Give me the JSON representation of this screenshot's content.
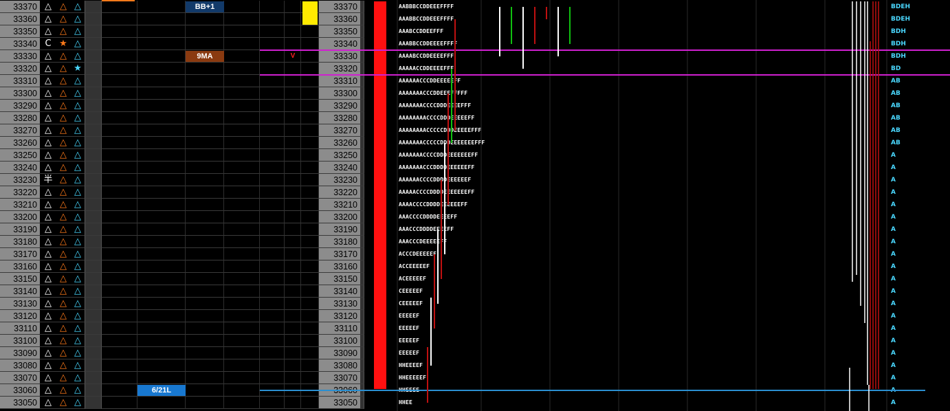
{
  "prices": [
    33370,
    33360,
    33350,
    33340,
    33330,
    33320,
    33310,
    33300,
    33290,
    33280,
    33270,
    33260,
    33250,
    33240,
    33230,
    33220,
    33210,
    33200,
    33190,
    33180,
    33170,
    33160,
    33150,
    33140,
    33130,
    33120,
    33110,
    33100,
    33090,
    33080,
    33070,
    33060,
    33050
  ],
  "icon_rows": [
    {
      "c1": "△",
      "c2": "△",
      "c3": "△"
    },
    {
      "c1": "△",
      "c2": "△",
      "c3": "△"
    },
    {
      "c1": "△",
      "c2": "△",
      "c3": "△"
    },
    {
      "c1": "C",
      "c2": "★",
      "c3": "△"
    },
    {
      "c1": "△",
      "c2": "△",
      "c3": "△"
    },
    {
      "c1": "△",
      "c2": "△",
      "c3": "★"
    },
    {
      "c1": "△",
      "c2": "△",
      "c3": "△"
    },
    {
      "c1": "△",
      "c2": "△",
      "c3": "△"
    },
    {
      "c1": "△",
      "c2": "△",
      "c3": "△"
    },
    {
      "c1": "△",
      "c2": "△",
      "c3": "△"
    },
    {
      "c1": "△",
      "c2": "△",
      "c3": "△"
    },
    {
      "c1": "△",
      "c2": "△",
      "c3": "△"
    },
    {
      "c1": "△",
      "c2": "△",
      "c3": "△"
    },
    {
      "c1": "△",
      "c2": "△",
      "c3": "△"
    },
    {
      "c1": "半",
      "c2": "△",
      "c3": "△"
    },
    {
      "c1": "△",
      "c2": "△",
      "c3": "△"
    },
    {
      "c1": "△",
      "c2": "△",
      "c3": "△"
    },
    {
      "c1": "△",
      "c2": "△",
      "c3": "△"
    },
    {
      "c1": "△",
      "c2": "△",
      "c3": "△"
    },
    {
      "c1": "△",
      "c2": "△",
      "c3": "△"
    },
    {
      "c1": "△",
      "c2": "△",
      "c3": "△"
    },
    {
      "c1": "△",
      "c2": "△",
      "c3": "△"
    },
    {
      "c1": "△",
      "c2": "△",
      "c3": "△"
    },
    {
      "c1": "△",
      "c2": "△",
      "c3": "△"
    },
    {
      "c1": "△",
      "c2": "△",
      "c3": "△"
    },
    {
      "c1": "△",
      "c2": "△",
      "c3": "△"
    },
    {
      "c1": "△",
      "c2": "△",
      "c3": "△"
    },
    {
      "c1": "△",
      "c2": "△",
      "c3": "△"
    },
    {
      "c1": "△",
      "c2": "△",
      "c3": "△"
    },
    {
      "c1": "△",
      "c2": "△",
      "c3": "△"
    },
    {
      "c1": "△",
      "c2": "△",
      "c3": "△"
    },
    {
      "c1": "△",
      "c2": "△",
      "c3": "△"
    },
    {
      "c1": "△",
      "c2": "△",
      "c3": "△"
    }
  ],
  "tags": {
    "bb": {
      "label": "BB+1",
      "price": 33370
    },
    "ma": {
      "label": "9MA",
      "price": 33330
    },
    "low": {
      "label": "6/21L",
      "price": 33060
    },
    "v": {
      "label": "V",
      "price": 33330
    }
  },
  "tpo_profile": [
    "AABBBCCDDEEEFFFF",
    "AAABBCCDDEEEFFFF",
    "AAABCCDDEEFFF",
    "AAABBCCDDEEEEFFFF",
    "AAAABCCDDEEEEFFF",
    "AAAAACCDDEEEEFFF",
    "AAAAAACCCDDEEEEEFF",
    "AAAAAAACCCDDEEEFFFFF",
    "AAAAAAACCCCDDDEEEEFFF",
    "AAAAAAAACCCCDDDEEEEEFF",
    "AAAAAAAACCCCCDDDEEEEEFFF",
    "AAAAAAACCCCCDDDEEEEEEEFFF",
    "AAAAAAACCCCDDDEEEEEEEFF",
    "AAAAAAACCCDDDDEEEEEEFF",
    "AAAAAACCCCDDDDEEEEEEF",
    "AAAAACCCCDDDDEEEEEEEFF",
    "AAAACCCCDDDDEEEEEEFF",
    "AAACCCCDDDDEEEEFF",
    "AAACCCDDDDEEEEFF",
    "AAACCCDEEEEEFF",
    "ACCCDEEEEEF",
    "ACCEEEEEF",
    "ACEEEEEF",
    "CEEEEEF",
    "CEEEEEF",
    "EEEEEF",
    "EEEEEF",
    "EEEEEF",
    "EEEEEF",
    "HHEEEEF",
    "HHEEEEEF",
    "HHEEEE",
    "HHEE"
  ],
  "right_labels": [
    "BDEH",
    "BDEH",
    "BDH",
    "BDH",
    "BDH",
    "BD",
    "AB",
    "AB",
    "AB",
    "AB",
    "AB",
    "AB",
    "A",
    "A",
    "A",
    "A",
    "A",
    "A",
    "A",
    "A",
    "A",
    "A",
    "A",
    "A",
    "A",
    "A",
    "A",
    "A",
    "A",
    "A",
    "A",
    "A",
    "A"
  ],
  "colors": {
    "price_bg": "#8c8c8c",
    "magenta": "#d020d0",
    "blue_line": "#2a8fd0",
    "red_bar": "#ff1010",
    "yellow": "#ffea00",
    "cyan": "#4ad8ff",
    "orange": "#ff7a1a"
  },
  "chart_data": {
    "type": "table",
    "price_levels_high": 33370,
    "price_levels_low": 33050,
    "tick_size": 10,
    "horizontal_lines": [
      {
        "color": "magenta",
        "price": 33335
      },
      {
        "color": "magenta",
        "price": 33315
      },
      {
        "color": "blue",
        "price": 33060
      }
    ],
    "candles": [
      {
        "x_index": 0,
        "high": 33095,
        "low": 33050,
        "color": "red"
      },
      {
        "x_index": 1,
        "high": 33135,
        "low": 33080,
        "color": "white"
      },
      {
        "x_index": 2,
        "high": 33170,
        "low": 33110,
        "color": "red"
      },
      {
        "x_index": 3,
        "high": 33190,
        "low": 33130,
        "color": "white"
      },
      {
        "x_index": 4,
        "high": 33230,
        "low": 33150,
        "color": "red"
      },
      {
        "x_index": 5,
        "high": 33260,
        "low": 33170,
        "color": "white"
      },
      {
        "x_index": 6,
        "high": 33300,
        "low": 33210,
        "color": "red"
      },
      {
        "x_index": 7,
        "high": 33320,
        "low": 33260,
        "color": "green"
      },
      {
        "x_index": 8,
        "high": 33360,
        "low": 33270,
        "color": "red"
      },
      {
        "x_index": 9,
        "high": 33370,
        "low": 33330,
        "color": "white"
      },
      {
        "x_index": 10,
        "high": 33370,
        "low": 33340,
        "color": "green"
      },
      {
        "x_index": 11,
        "high": 33370,
        "low": 33320,
        "color": "white"
      },
      {
        "x_index": 12,
        "high": 33370,
        "low": 33340,
        "color": "red"
      },
      {
        "x_index": 13,
        "high": 33370,
        "low": 33360,
        "color": "red"
      },
      {
        "x_index": 14,
        "high": 33370,
        "low": 33330,
        "color": "white"
      },
      {
        "x_index": 15,
        "high": 33370,
        "low": 33340,
        "color": "green"
      }
    ]
  }
}
